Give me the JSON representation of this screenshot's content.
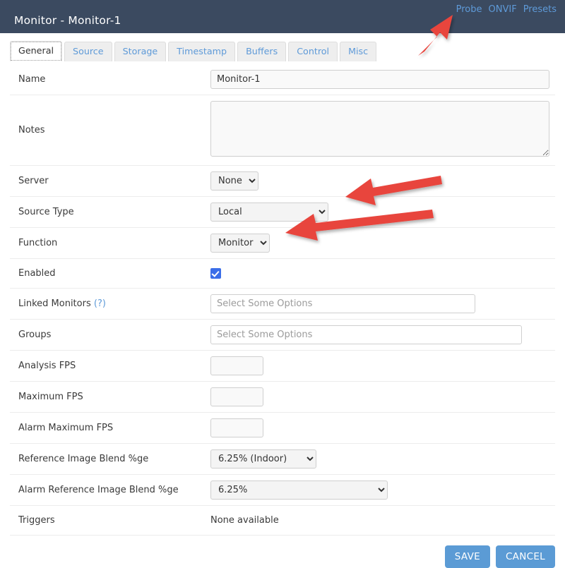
{
  "header": {
    "title": "Monitor - Monitor-1",
    "links": [
      {
        "label": "Probe",
        "name": "probe-link"
      },
      {
        "label": "ONVIF",
        "name": "onvif-link"
      },
      {
        "label": "Presets",
        "name": "presets-link"
      }
    ]
  },
  "tabs": [
    {
      "label": "General",
      "active": true
    },
    {
      "label": "Source",
      "active": false
    },
    {
      "label": "Storage",
      "active": false
    },
    {
      "label": "Timestamp",
      "active": false
    },
    {
      "label": "Buffers",
      "active": false
    },
    {
      "label": "Control",
      "active": false
    },
    {
      "label": "Misc",
      "active": false
    }
  ],
  "form": {
    "name": {
      "label": "Name",
      "value": "Monitor-1"
    },
    "notes": {
      "label": "Notes",
      "value": ""
    },
    "server": {
      "label": "Server",
      "value": "None",
      "options": [
        "None"
      ]
    },
    "source_type": {
      "label": "Source Type",
      "value": "Local",
      "options": [
        "Local"
      ]
    },
    "function": {
      "label": "Function",
      "value": "Monitor",
      "options": [
        "Monitor"
      ]
    },
    "enabled": {
      "label": "Enabled",
      "checked": true
    },
    "linked_monitors": {
      "label": "Linked Monitors",
      "help": "(?)",
      "placeholder": "Select Some Options",
      "value": ""
    },
    "groups": {
      "label": "Groups",
      "placeholder": "Select Some Options",
      "value": ""
    },
    "analysis_fps": {
      "label": "Analysis FPS",
      "value": ""
    },
    "maximum_fps": {
      "label": "Maximum FPS",
      "value": ""
    },
    "alarm_maximum_fps": {
      "label": "Alarm Maximum FPS",
      "value": ""
    },
    "reference_blend": {
      "label": "Reference Image Blend %ge",
      "value": "6.25% (Indoor)",
      "options": [
        "6.25% (Indoor)"
      ]
    },
    "alarm_reference_blend": {
      "label": "Alarm Reference Image Blend %ge",
      "value": "6.25%",
      "options": [
        "6.25%"
      ]
    },
    "triggers": {
      "label": "Triggers",
      "value": "None available"
    }
  },
  "footer": {
    "save_label": "SAVE",
    "cancel_label": "CANCEL"
  },
  "colors": {
    "header_bg": "#3b4a60",
    "link_blue": "#5e9ad8",
    "button_blue": "#5b9bd5",
    "checkbox_blue": "#3b6ee8",
    "annotation_red": "#e8443c"
  },
  "annotations": [
    {
      "name": "arrow-to-probe",
      "target": "Probe"
    },
    {
      "name": "arrow-to-source-type",
      "target": "Source Type"
    },
    {
      "name": "arrow-to-function",
      "target": "Function"
    }
  ]
}
